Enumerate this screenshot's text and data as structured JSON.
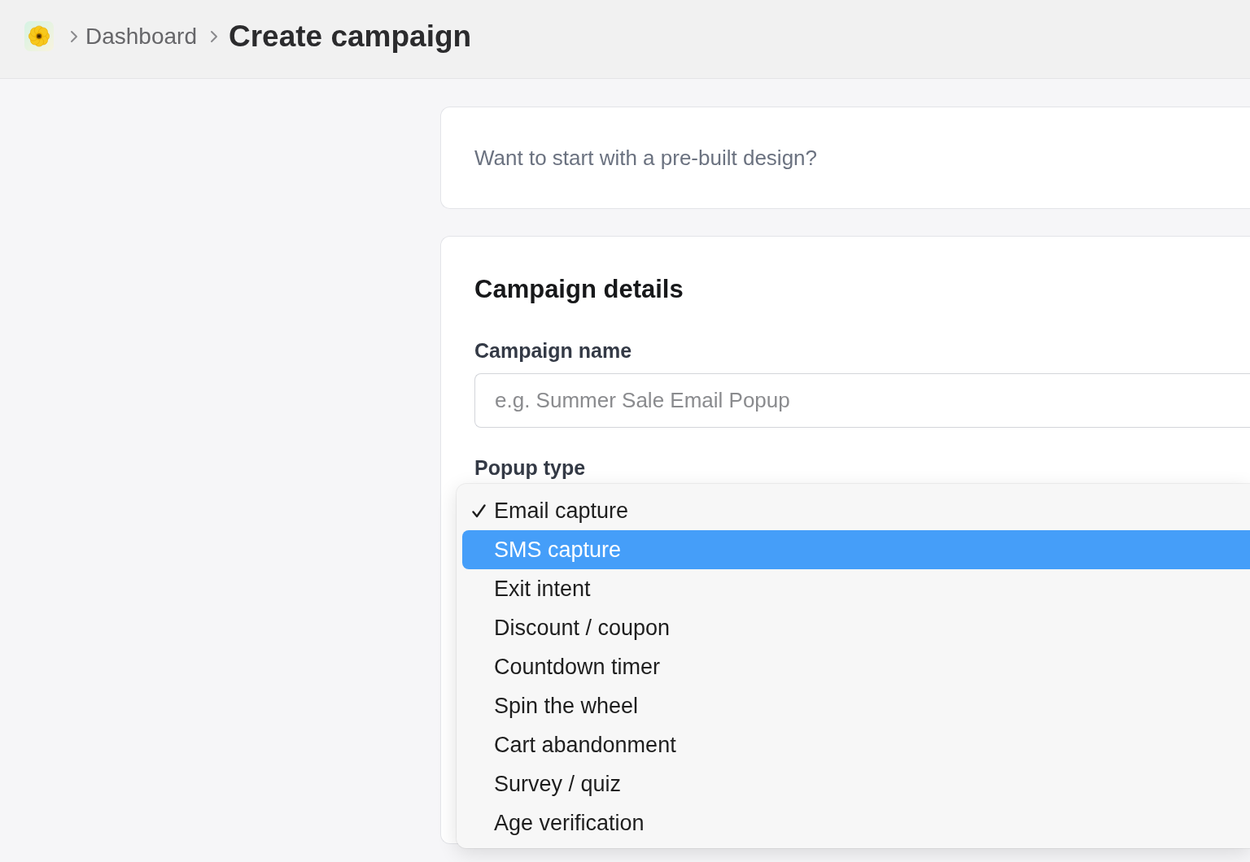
{
  "breadcrumb": {
    "items": [
      {
        "label": "Dashboard"
      }
    ],
    "current": "Create campaign"
  },
  "template_prompt": {
    "text": "Want to start with a pre-built design?"
  },
  "campaign_details": {
    "title": "Campaign details",
    "campaign_name": {
      "label": "Campaign name",
      "placeholder": "e.g. Summer Sale Email Popup"
    },
    "popup_type": {
      "label": "Popup type",
      "menu": {
        "items": [
          {
            "label": "Email capture",
            "selected": true,
            "highlighted": false
          },
          {
            "label": "SMS capture",
            "selected": false,
            "highlighted": true
          },
          {
            "label": "Exit intent",
            "selected": false,
            "highlighted": false
          },
          {
            "label": "Discount / coupon",
            "selected": false,
            "highlighted": false
          },
          {
            "label": "Countdown timer",
            "selected": false,
            "highlighted": false
          },
          {
            "label": "Spin the wheel",
            "selected": false,
            "highlighted": false
          },
          {
            "label": "Cart abandonment",
            "selected": false,
            "highlighted": false
          },
          {
            "label": "Survey / quiz",
            "selected": false,
            "highlighted": false
          },
          {
            "label": "Age verification",
            "selected": false,
            "highlighted": false
          }
        ]
      }
    }
  }
}
